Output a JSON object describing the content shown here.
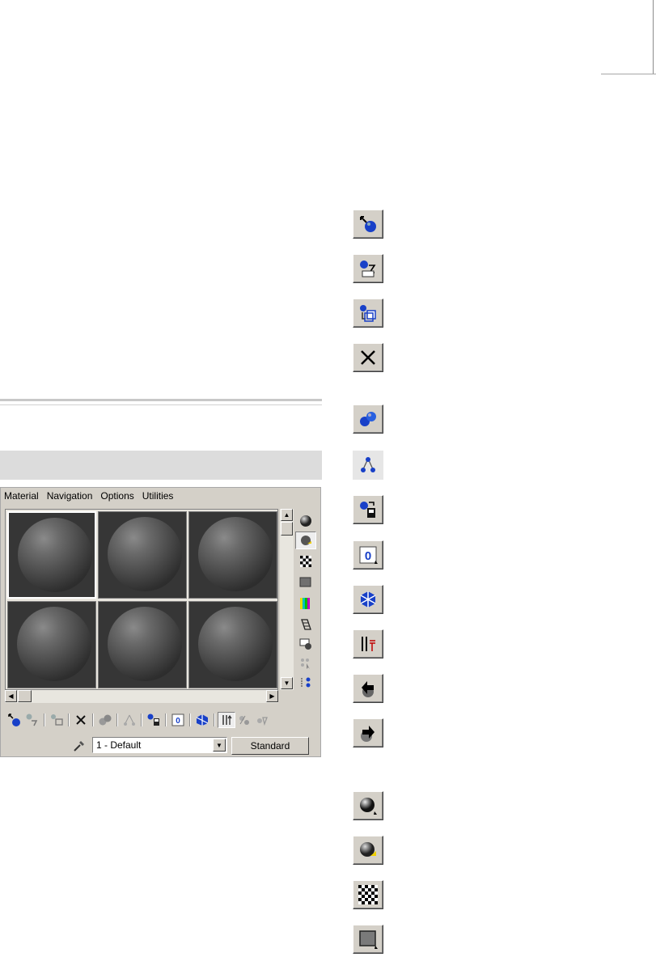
{
  "menu": [
    "Material",
    "Navigation",
    "Options",
    "Utilities"
  ],
  "material_slots": [
    {
      "id": "slot-1",
      "active": true
    },
    {
      "id": "slot-2",
      "active": false
    },
    {
      "id": "slot-3",
      "active": false
    },
    {
      "id": "slot-4",
      "active": false
    },
    {
      "id": "slot-5",
      "active": false
    },
    {
      "id": "slot-6",
      "active": false
    }
  ],
  "side_toolbar": [
    "sample-type-sphere-icon",
    "backlight-icon",
    "background-checker-icon",
    "sample-uv-tiling-icon",
    "video-color-check-icon",
    "make-preview-icon",
    "options-icon",
    "select-by-material-icon",
    "material-map-navigator-icon"
  ],
  "bottom_toolbar": [
    "get-material-icon",
    "put-material-icon",
    "assign-to-selection-icon",
    "reset-map-icon",
    "make-unique-icon",
    "go-to-parent-icon",
    "put-to-library-icon",
    "material-effects-channel-icon",
    "show-map-in-viewport-icon",
    "show-end-result-icon",
    "go-forward-to-sibling-icon",
    "go-to-parent-alt-icon"
  ],
  "material_name": "1 - Default",
  "material_type": "Standard",
  "right_column_icons": [
    "get-material-icon",
    "put-material-icon",
    "assign-to-selection-icon",
    "reset-map-icon",
    "make-unique-icon",
    "go-to-parent-icon",
    "put-to-library-icon",
    "material-effects-channel-icon",
    "show-map-in-viewport-icon",
    "show-end-result-icon",
    "go-to-parent-arrow-icon",
    "go-forward-to-sibling-icon",
    "sample-type-sphere-icon",
    "backlight-icon",
    "background-checker-icon",
    "sample-uv-tiling-icon"
  ],
  "colors": {
    "ui_gray": "#d4d0c8",
    "slot_bg": "#363636",
    "blue_sphere": "#1840c8"
  }
}
